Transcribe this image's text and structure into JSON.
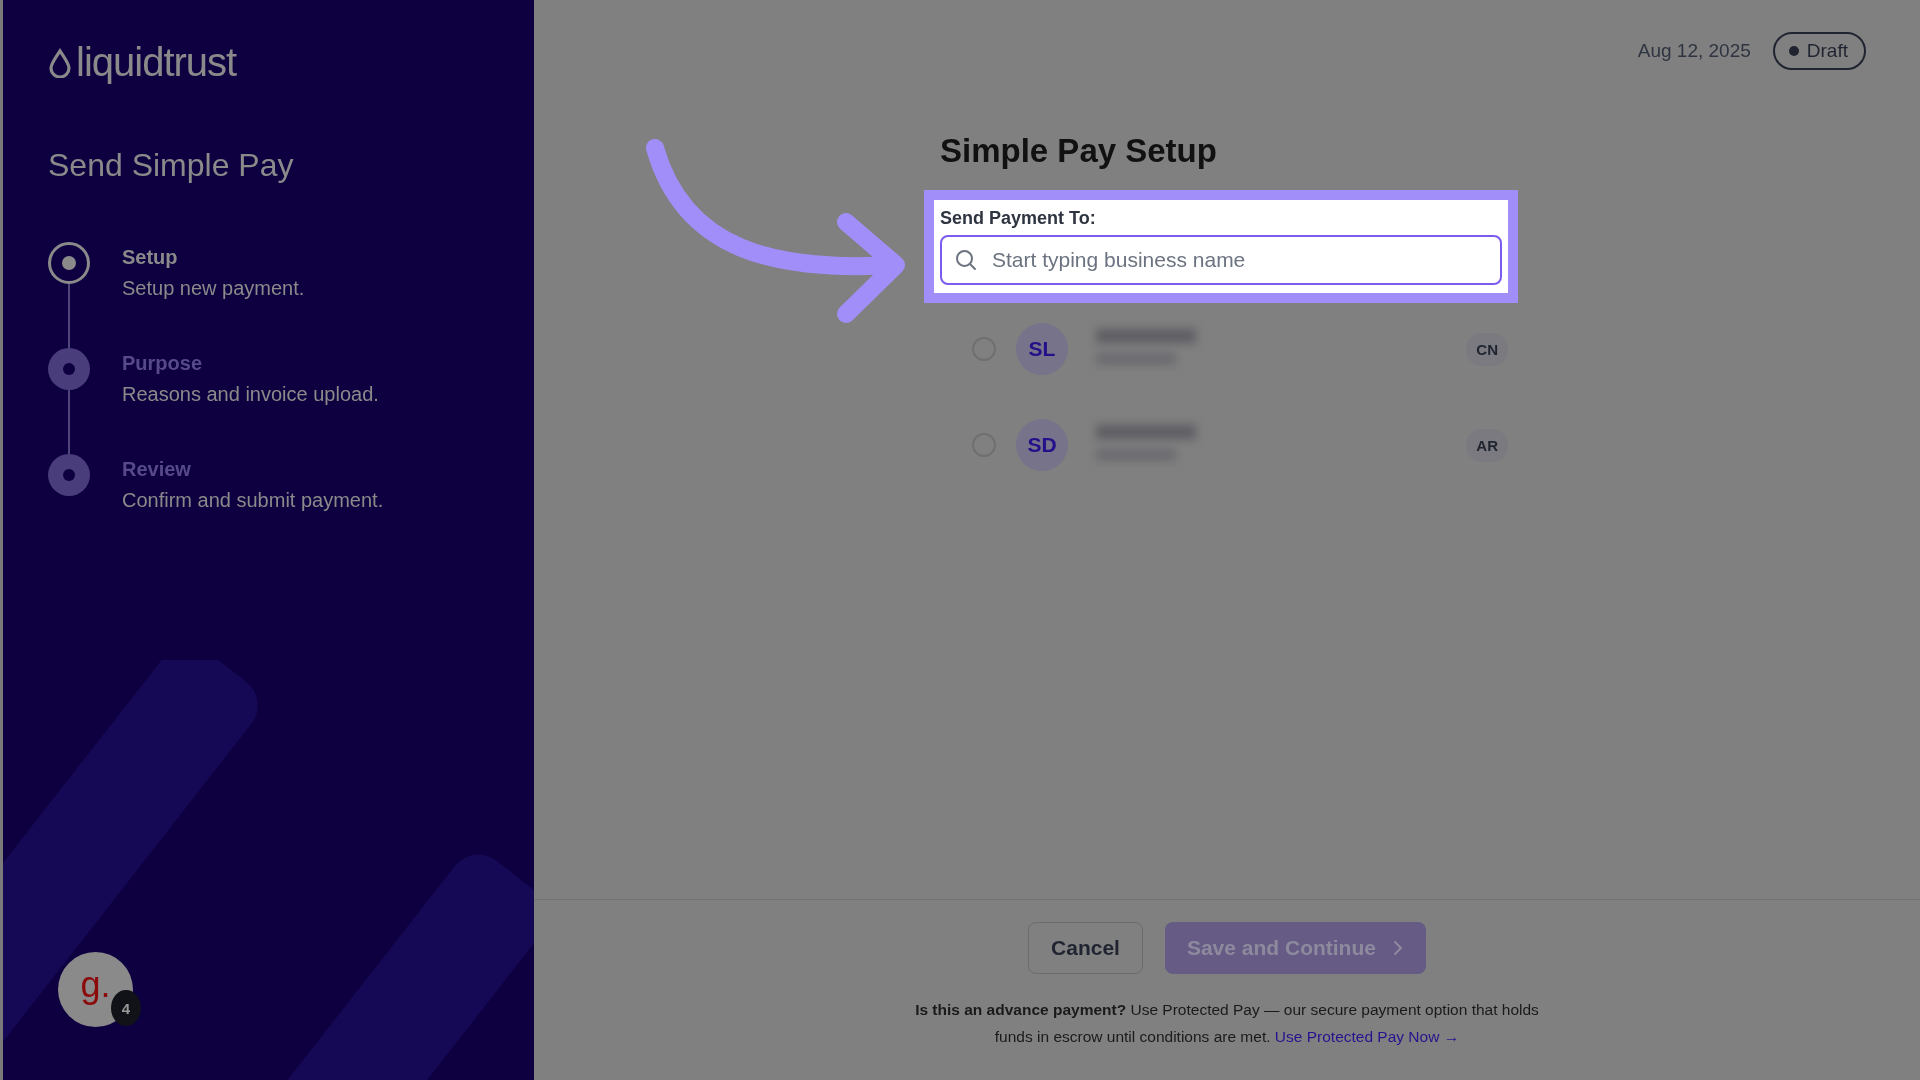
{
  "sidebar": {
    "logo": "liquidtrust",
    "title": "Send Simple Pay",
    "steps": [
      {
        "title": "Setup",
        "description": "Setup new payment.",
        "selected": true
      },
      {
        "title": "Purpose",
        "description": "Reasons and invoice upload.",
        "selected": false
      },
      {
        "title": "Review",
        "description": "Confirm and submit payment.",
        "selected": false
      }
    ],
    "avatar": {
      "letter": "g.",
      "badge": "4"
    }
  },
  "header": {
    "date": "Aug 12, 2025",
    "status": "Draft"
  },
  "main": {
    "title": "Simple Pay Setup",
    "field": {
      "label": "Send Payment To:",
      "placeholder": "Start typing business name"
    },
    "recipients": [
      {
        "initials": "SL",
        "tag": "CN",
        "selected": false
      },
      {
        "initials": "SD",
        "tag": "AR",
        "selected": false
      }
    ]
  },
  "footer": {
    "buttons": [
      {
        "label": "Cancel",
        "kind": "secondary",
        "disabled": false
      },
      {
        "label": "Save and Continue",
        "kind": "primary",
        "disabled": true
      }
    ],
    "note": "**Is this an advance payment?** Use Protected Pay — our secure payment option that holds funds in escrow until conditions are met.",
    "link": "Use Protected Pay Now →"
  }
}
